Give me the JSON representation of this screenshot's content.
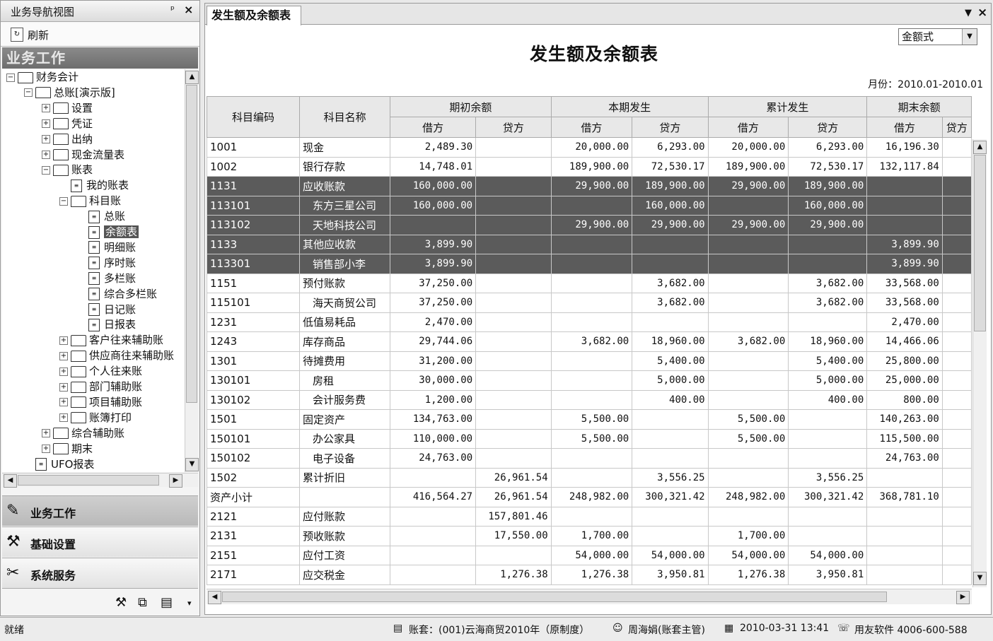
{
  "nav": {
    "title": "业务导航视图",
    "pin": "ᵖ",
    "refresh": "刷新",
    "banner": "业务工作",
    "tree": [
      {
        "label": "财务会计",
        "level": 0,
        "type": "folder",
        "exp": "−"
      },
      {
        "label": "总账[演示版]",
        "level": 1,
        "type": "folder",
        "exp": "−"
      },
      {
        "label": "设置",
        "level": 2,
        "type": "folder",
        "exp": "+"
      },
      {
        "label": "凭证",
        "level": 2,
        "type": "folder",
        "exp": "+"
      },
      {
        "label": "出纳",
        "level": 2,
        "type": "folder",
        "exp": "+"
      },
      {
        "label": "现金流量表",
        "level": 2,
        "type": "folder",
        "exp": "+"
      },
      {
        "label": "账表",
        "level": 2,
        "type": "folder",
        "exp": "−"
      },
      {
        "label": "我的账表",
        "level": 3,
        "type": "doc"
      },
      {
        "label": "科目账",
        "level": 3,
        "type": "folder",
        "exp": "−"
      },
      {
        "label": "总账",
        "level": 4,
        "type": "doc"
      },
      {
        "label": "余额表",
        "level": 4,
        "type": "doc",
        "selected": true
      },
      {
        "label": "明细账",
        "level": 4,
        "type": "doc"
      },
      {
        "label": "序时账",
        "level": 4,
        "type": "doc"
      },
      {
        "label": "多栏账",
        "level": 4,
        "type": "doc"
      },
      {
        "label": "综合多栏账",
        "level": 4,
        "type": "doc"
      },
      {
        "label": "日记账",
        "level": 4,
        "type": "doc"
      },
      {
        "label": "日报表",
        "level": 4,
        "type": "doc"
      },
      {
        "label": "客户往来辅助账",
        "level": 3,
        "type": "folder",
        "exp": "+"
      },
      {
        "label": "供应商往来辅助账",
        "level": 3,
        "type": "folder",
        "exp": "+"
      },
      {
        "label": "个人往来账",
        "level": 3,
        "type": "folder",
        "exp": "+"
      },
      {
        "label": "部门辅助账",
        "level": 3,
        "type": "folder",
        "exp": "+"
      },
      {
        "label": "项目辅助账",
        "level": 3,
        "type": "folder",
        "exp": "+"
      },
      {
        "label": "账簿打印",
        "level": 3,
        "type": "folder",
        "exp": "+"
      },
      {
        "label": "综合辅助账",
        "level": 2,
        "type": "folder",
        "exp": "+"
      },
      {
        "label": "期末",
        "level": 2,
        "type": "folder",
        "exp": "+"
      },
      {
        "label": "UFO报表",
        "level": 1,
        "type": "doc"
      }
    ],
    "buttons": [
      {
        "label": "业务工作",
        "icon": "✎"
      },
      {
        "label": "基础设置",
        "icon": "⚒"
      },
      {
        "label": "系统服务",
        "icon": "✂"
      }
    ]
  },
  "doc": {
    "tab": "发生额及余额表",
    "title": "发生额及余额表",
    "amount_type": "金额式",
    "month_label": "月份：2010.01-2010.01",
    "headers": {
      "code": "科目编码",
      "name": "科目名称",
      "groups": [
        "期初余额",
        "本期发生",
        "累计发生",
        "期末余额"
      ],
      "debit": "借方",
      "credit": "贷方"
    },
    "rows": [
      {
        "code": "1001",
        "name": "现金",
        "v": [
          "2,489.30",
          "",
          "20,000.00",
          "6,293.00",
          "20,000.00",
          "6,293.00",
          "16,196.30"
        ]
      },
      {
        "code": "1002",
        "name": "银行存款",
        "v": [
          "14,748.01",
          "",
          "189,900.00",
          "72,530.17",
          "189,900.00",
          "72,530.17",
          "132,117.84"
        ]
      },
      {
        "code": "1131",
        "name": "应收账款",
        "dark": true,
        "v": [
          "160,000.00",
          "",
          "29,900.00",
          "189,900.00",
          "29,900.00",
          "189,900.00",
          ""
        ]
      },
      {
        "code": "113101",
        "name": "东方三星公司",
        "sub": true,
        "dark": true,
        "v": [
          "160,000.00",
          "",
          "",
          "160,000.00",
          "",
          "160,000.00",
          ""
        ]
      },
      {
        "code": "113102",
        "name": "天地科技公司",
        "sub": true,
        "dark": true,
        "v": [
          "",
          "",
          "29,900.00",
          "29,900.00",
          "29,900.00",
          "29,900.00",
          ""
        ]
      },
      {
        "code": "1133",
        "name": "其他应收款",
        "dark": true,
        "v": [
          "3,899.90",
          "",
          "",
          "",
          "",
          "",
          "3,899.90"
        ]
      },
      {
        "code": "113301",
        "name": "销售部小李",
        "sub": true,
        "dark": true,
        "v": [
          "3,899.90",
          "",
          "",
          "",
          "",
          "",
          "3,899.90"
        ]
      },
      {
        "code": "1151",
        "name": "预付账款",
        "v": [
          "37,250.00",
          "",
          "",
          "3,682.00",
          "",
          "3,682.00",
          "33,568.00"
        ]
      },
      {
        "code": "115101",
        "name": "海天商贸公司",
        "sub": true,
        "v": [
          "37,250.00",
          "",
          "",
          "3,682.00",
          "",
          "3,682.00",
          "33,568.00"
        ]
      },
      {
        "code": "1231",
        "name": "低值易耗品",
        "v": [
          "2,470.00",
          "",
          "",
          "",
          "",
          "",
          "2,470.00"
        ]
      },
      {
        "code": "1243",
        "name": "库存商品",
        "v": [
          "29,744.06",
          "",
          "3,682.00",
          "18,960.00",
          "3,682.00",
          "18,960.00",
          "14,466.06"
        ]
      },
      {
        "code": "1301",
        "name": "待摊费用",
        "v": [
          "31,200.00",
          "",
          "",
          "5,400.00",
          "",
          "5,400.00",
          "25,800.00"
        ]
      },
      {
        "code": "130101",
        "name": "房租",
        "sub": true,
        "v": [
          "30,000.00",
          "",
          "",
          "5,000.00",
          "",
          "5,000.00",
          "25,000.00"
        ]
      },
      {
        "code": "130102",
        "name": "会计服务费",
        "sub": true,
        "v": [
          "1,200.00",
          "",
          "",
          "400.00",
          "",
          "400.00",
          "800.00"
        ]
      },
      {
        "code": "1501",
        "name": "固定资产",
        "v": [
          "134,763.00",
          "",
          "5,500.00",
          "",
          "5,500.00",
          "",
          "140,263.00"
        ]
      },
      {
        "code": "150101",
        "name": "办公家具",
        "sub": true,
        "v": [
          "110,000.00",
          "",
          "5,500.00",
          "",
          "5,500.00",
          "",
          "115,500.00"
        ]
      },
      {
        "code": "150102",
        "name": "电子设备",
        "sub": true,
        "v": [
          "24,763.00",
          "",
          "",
          "",
          "",
          "",
          "24,763.00"
        ]
      },
      {
        "code": "1502",
        "name": "累计折旧",
        "v": [
          "",
          "26,961.54",
          "",
          "3,556.25",
          "",
          "3,556.25",
          ""
        ]
      },
      {
        "code": "资产小计",
        "name": "",
        "v": [
          "416,564.27",
          "26,961.54",
          "248,982.00",
          "300,321.42",
          "248,982.00",
          "300,321.42",
          "368,781.10"
        ]
      },
      {
        "code": "2121",
        "name": "应付账款",
        "v": [
          "",
          "157,801.46",
          "",
          "",
          "",
          "",
          ""
        ]
      },
      {
        "code": "2131",
        "name": "预收账款",
        "v": [
          "",
          "17,550.00",
          "1,700.00",
          "",
          "1,700.00",
          "",
          ""
        ]
      },
      {
        "code": "2151",
        "name": "应付工资",
        "v": [
          "",
          "",
          "54,000.00",
          "54,000.00",
          "54,000.00",
          "54,000.00",
          ""
        ]
      },
      {
        "code": "2171",
        "name": "应交税金",
        "v": [
          "",
          "1,276.38",
          "1,276.38",
          "3,950.81",
          "1,276.38",
          "3,950.81",
          ""
        ]
      }
    ]
  },
  "status": {
    "ready": "就绪",
    "account": "账套：(001)云海商贸2010年（原制度）",
    "user": "周海娟(账套主管)",
    "datetime": "2010-03-31  13:41",
    "vendor": "用友软件 4006-600-588"
  }
}
